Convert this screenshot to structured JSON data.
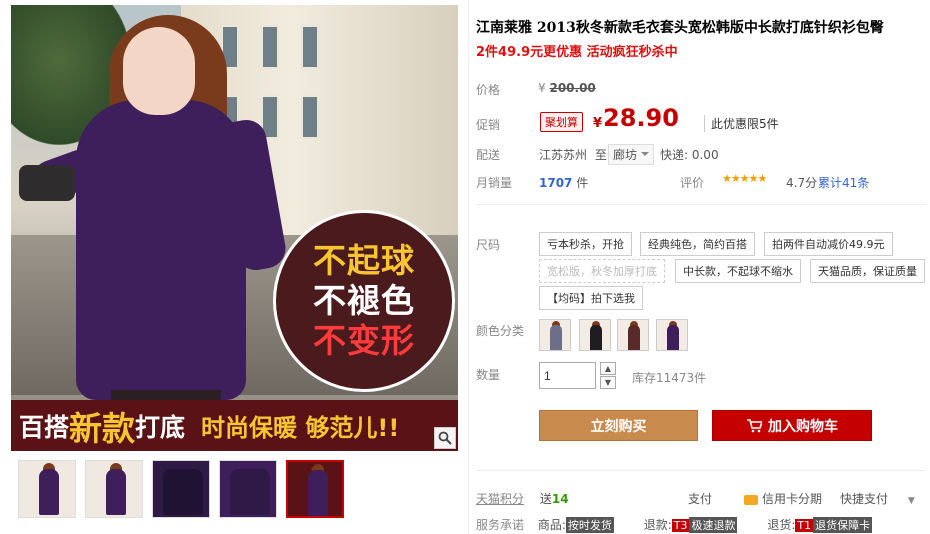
{
  "gallery": {
    "promo_lines": [
      "不起球",
      "不褪色",
      "不变形"
    ],
    "promo_colors": [
      "#f7c531",
      "#ffffff",
      "#ff3b3b"
    ],
    "banner": {
      "part1": "百搭",
      "part2": "新款",
      "part3": "打底",
      "part4": "时尚保暖 够范儿!!"
    },
    "zoom_icon": "magnifier-icon",
    "thumbnails": [
      {
        "color": "#3e1f5c",
        "active": false
      },
      {
        "color": "#3e1f5c",
        "active": false
      },
      {
        "color": "#2f1a47",
        "active": false
      },
      {
        "color": "#3e1f5c",
        "active": false
      },
      {
        "color": "#3e1f5c",
        "active": true
      }
    ]
  },
  "product": {
    "title": "江南莱雅 2013秋冬新款毛衣套头宽松韩版中长款打底针织衫包臀",
    "subtitle": "2件49.9元更优惠 活动疯狂秒杀中"
  },
  "price": {
    "orig_label": "价格",
    "orig_currency": "¥",
    "orig_value": "200.00",
    "promo_label": "促销",
    "promo_tag": "聚划算",
    "currency": "¥",
    "value": "28.90",
    "note": "此优惠限5件"
  },
  "shipping": {
    "label": "配送",
    "from": "江苏苏州",
    "to_prefix": "至",
    "to": "廊坊",
    "fee": "快递: 0.00"
  },
  "sales": {
    "label": "月销量",
    "count": "1707",
    "unit": "件",
    "rating_label": "评价",
    "stars": "★★★★★",
    "score": "4.7分",
    "reviews": "累计41条"
  },
  "size": {
    "label": "尺码",
    "options": [
      {
        "text": "亏本秒杀，开抢",
        "disabled": false
      },
      {
        "text": "经典纯色，简约百搭",
        "disabled": false
      },
      {
        "text": "拍两件自动减价49.9元",
        "disabled": false
      },
      {
        "text": "宽松版，秋冬加厚打底",
        "disabled": true
      },
      {
        "text": "中长款，不起球不缩水",
        "disabled": false
      },
      {
        "text": "天猫品质，保证质量",
        "disabled": false
      },
      {
        "text": "【均码】拍下选我",
        "disabled": false
      }
    ]
  },
  "color": {
    "label": "颜色分类",
    "swatches": [
      "#6d6f8a",
      "#1f1c22",
      "#5a2a2a",
      "#3e1f5c"
    ]
  },
  "quantity": {
    "label": "数量",
    "value": "1",
    "stock": "库存11473件"
  },
  "buttons": {
    "buy": "立刻购买",
    "cart": "加入购物车"
  },
  "footer": {
    "points_label": "天猫积分",
    "points_prefix": "送",
    "points_value": "14",
    "pay_label": "支付",
    "credit": "信用卡分期",
    "quick_pay": "快捷支付",
    "service_label": "服务承诺",
    "goods_label": "商品:",
    "goods_badge": "按时发货",
    "refund_label": "退款:",
    "refund_code": "T3",
    "refund_badge": "极速退款",
    "return_label": "退货:",
    "return_code": "T1",
    "return_badge": "退货保障卡"
  }
}
